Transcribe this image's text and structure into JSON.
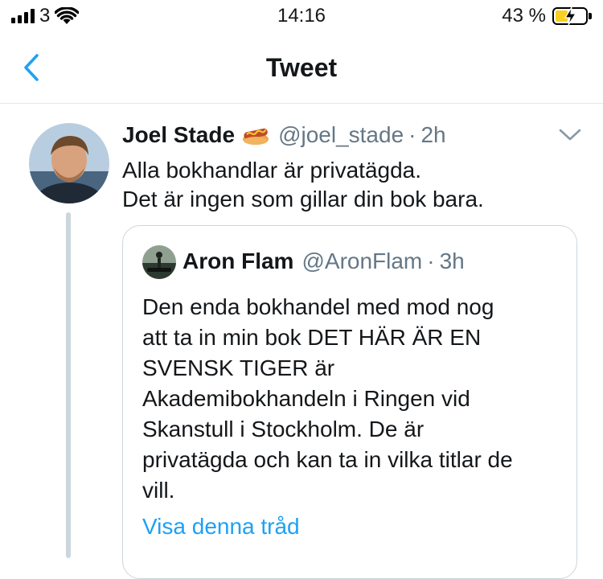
{
  "status_bar": {
    "carrier": "3",
    "time": "14:16",
    "battery_percent": "43 %",
    "battery_level": 0.43,
    "battery_color": "#f7d020",
    "icons": [
      "signal-icon",
      "wifi-icon",
      "battery-charging-icon"
    ]
  },
  "nav": {
    "title": "Tweet",
    "back_icon": "chevron-left-icon",
    "accent_color": "#1da1f2"
  },
  "tweet": {
    "author_name": "Joel Stade",
    "author_emoji": "hot-dog-icon",
    "handle": "@joel_stade",
    "separator": "·",
    "time": "2h",
    "text_lines": [
      "Alla bokhandlar är privatägda.",
      "Det är ingen som gillar din bok bara."
    ],
    "menu_icon": "chevron-down-icon",
    "quoted": {
      "author_name": "Aron Flam",
      "handle": "@AronFlam",
      "separator": "·",
      "time": "3h",
      "text_lines": [
        "Den enda bokhandel med mod nog",
        "att ta in min bok DET HÄR ÄR EN",
        "SVENSK TIGER är",
        "Akademibokhandeln i Ringen vid",
        "Skanstull i Stockholm. De är",
        "privatägda och kan ta in vilka titlar de",
        "vill."
      ],
      "show_thread": "Visa denna tråd"
    }
  }
}
